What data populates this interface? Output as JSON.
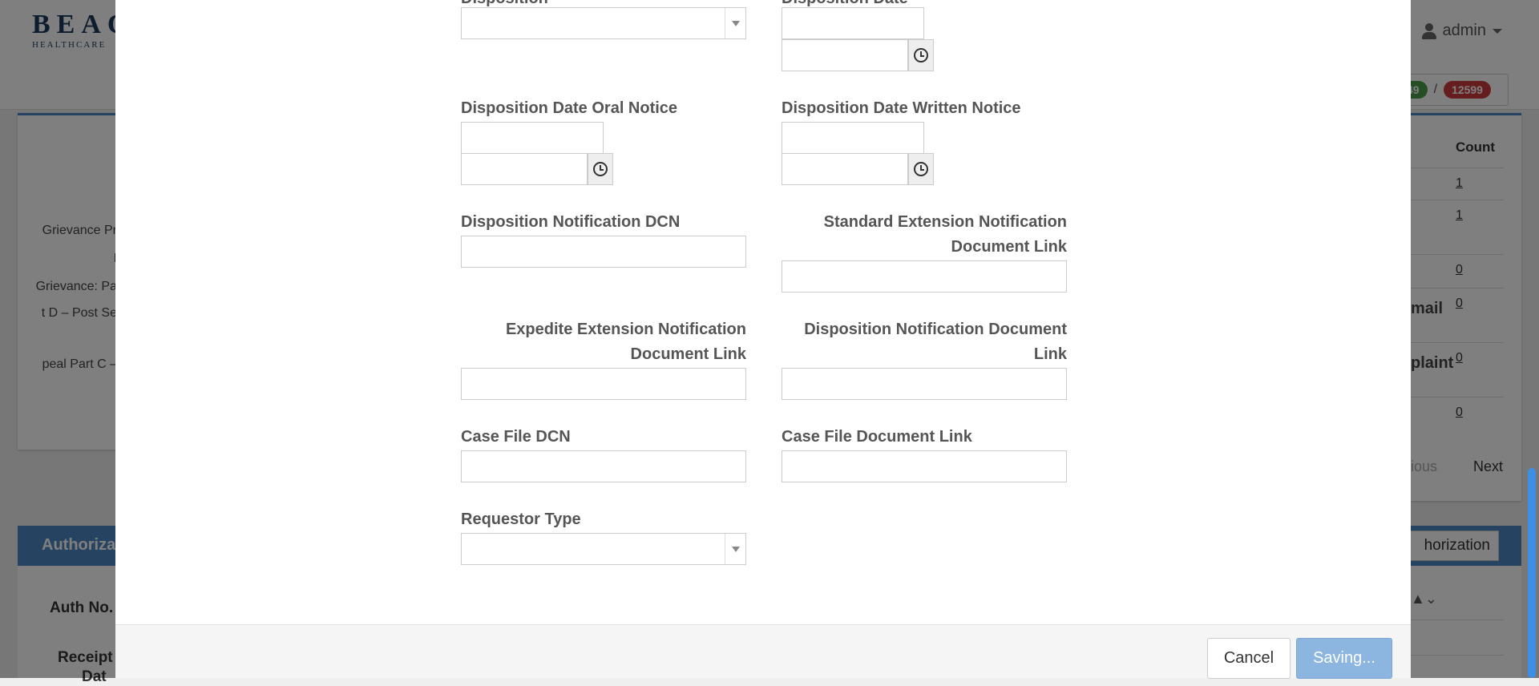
{
  "background": {
    "logo_text": "BEAC",
    "logo_sub": "HEALTHCARE",
    "user_label": "admin",
    "counter_green": "49",
    "counter_separator": "/",
    "counter_red": "12599",
    "left_rows": [
      "Grievance Pr",
      "I",
      "Grievance: Pa",
      "t D – Post Se",
      "peal Part C –"
    ],
    "count_header": "Count",
    "count_rows": [
      {
        "label": "",
        "value": "1"
      },
      {
        "label": "",
        "value": "1"
      },
      {
        "label": "",
        "value": "0"
      },
      {
        "label": "mail",
        "value": "0"
      },
      {
        "label": "plaint",
        "value": "0"
      },
      {
        "label": "",
        "value": "0"
      }
    ],
    "pager_previous": "ious",
    "pager_next": "Next",
    "auth_title": "Authoriza",
    "auth_button": "horization",
    "auth_no_label": "Auth No.",
    "receipt_label": "Receipt",
    "receipt_label_2": "Dat"
  },
  "form": {
    "disposition_label": "Disposition",
    "disposition_date_label": "Disposition Date",
    "oral_notice_label": "Disposition Date Oral Notice",
    "written_notice_label": "Disposition Date Written Notice",
    "notification_dcn_label": "Disposition Notification DCN",
    "standard_ext_label_1": "Standard Extension Notification",
    "standard_ext_label_2": "Document Link",
    "expedite_ext_label_1": "Expedite Extension Notification",
    "expedite_ext_label_2": "Document Link",
    "notification_doc_label_1": "Disposition Notification Document",
    "notification_doc_label_2": "Link",
    "case_file_dcn_label": "Case File DCN",
    "case_file_link_label": "Case File Document Link",
    "requestor_type_label": "Requestor Type"
  },
  "footer": {
    "cancel_label": "Cancel",
    "save_label": "Saving..."
  }
}
